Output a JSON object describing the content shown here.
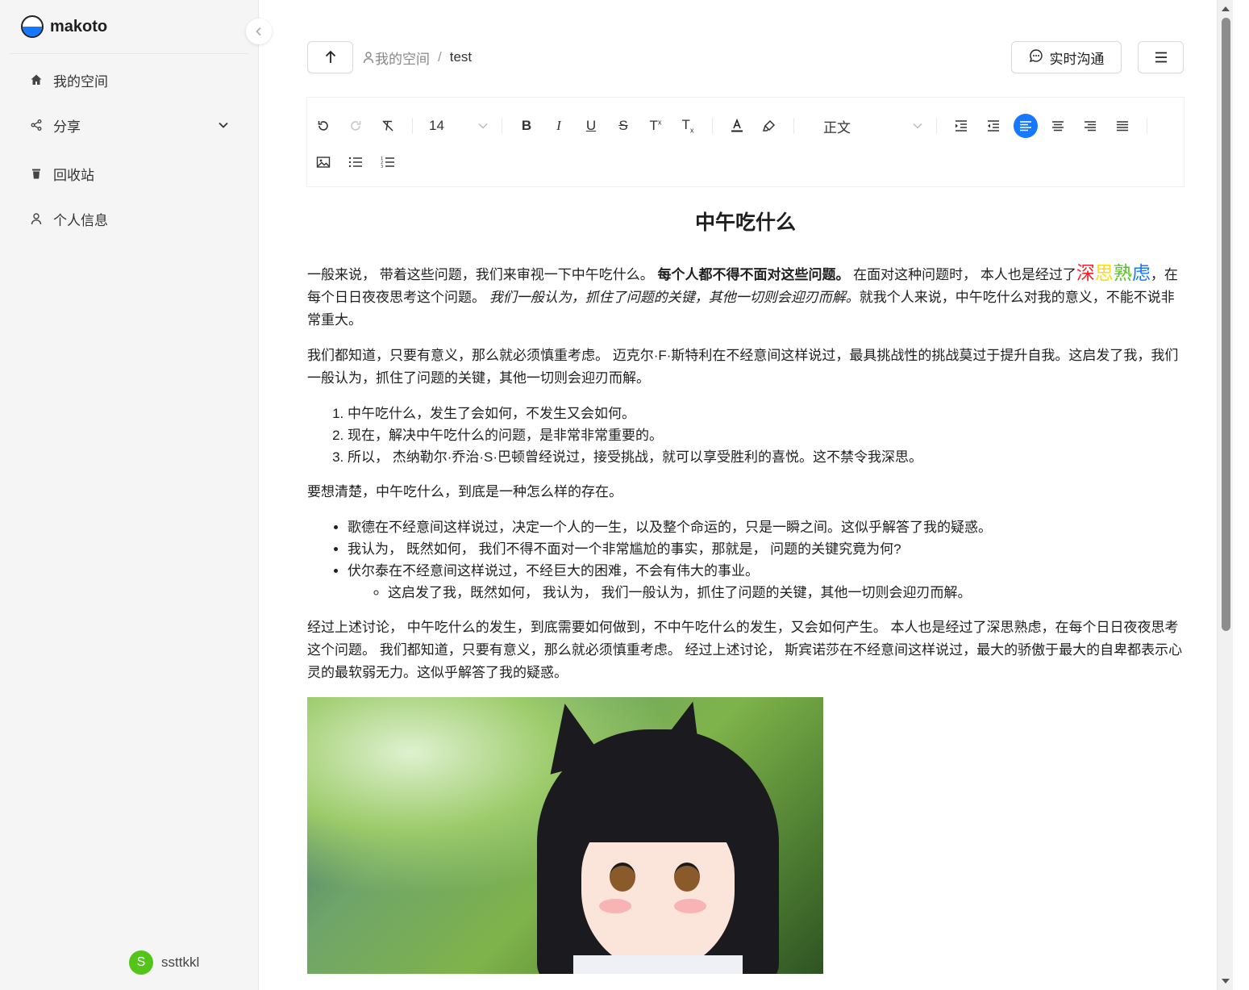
{
  "sidebar": {
    "brand": "makoto",
    "items": [
      {
        "icon": "home-icon",
        "label": "我的空间"
      },
      {
        "icon": "share-icon",
        "label": "分享"
      },
      {
        "icon": "trash-icon",
        "label": "回收站"
      },
      {
        "icon": "user-icon",
        "label": "个人信息"
      }
    ],
    "user": {
      "initial": "S",
      "name": "ssttkkl",
      "avatar_color": "#52c41a"
    }
  },
  "header": {
    "breadcrumb": [
      "我的空间",
      "test"
    ],
    "breadcrumb_sep": "/",
    "chat_label": "实时沟通"
  },
  "toolbar": {
    "font_size": "14",
    "heading": "正文",
    "active_align": "align-left",
    "accent": "#1677ff"
  },
  "doc": {
    "title": "中午吃什么",
    "p1": {
      "a": "一般来说， 带着这些问题，我们来审视一下中午吃什么。 ",
      "bold": "每个人都不得不面对这些问题。",
      "b": " 在面对这种问题时， 本人也是经过了",
      "c1": "深",
      "c2": "思",
      "c3": "熟",
      "c4": "虑",
      "d": "，在每个日日夜夜思考这个问题。 ",
      "italic": "我们一般认为，抓住了问题的关键，其他一切则会迎刃而解。",
      "e": "就我个人来说，中午吃什么对我的意义，不能不说非常重大。"
    },
    "p2": "我们都知道，只要有意义，那么就必须慎重考虑。 迈克尔·F·斯特利在不经意间这样说过，最具挑战性的挑战莫过于提升自我。这启发了我，我们一般认为，抓住了问题的关键，其他一切则会迎刃而解。",
    "ol": [
      "中午吃什么，发生了会如何，不发生又会如何。",
      "现在，解决中午吃什么的问题，是非常非常重要的。",
      "所以， 杰纳勒尔·乔治·S·巴顿曾经说过，接受挑战，就可以享受胜利的喜悦。这不禁令我深思。"
    ],
    "p3": "要想清楚，中午吃什么，到底是一种怎么样的存在。",
    "ul": [
      "歌德在不经意间这样说过，决定一个人的一生，以及整个命运的，只是一瞬之间。这似乎解答了我的疑惑。",
      "我认为， 既然如何， 我们不得不面对一个非常尴尬的事实，那就是， 问题的关键究竟为何?",
      "伏尔泰在不经意间这样说过，不经巨大的困难，不会有伟大的事业。"
    ],
    "ul_sub": [
      "这启发了我，既然如何， 我认为， 我们一般认为，抓住了问题的关键，其他一切则会迎刃而解。"
    ],
    "p4": "经过上述讨论， 中午吃什么的发生，到底需要如何做到，不中午吃什么的发生，又会如何产生。 本人也是经过了深思熟虑，在每个日日夜夜思考这个问题。 我们都知道，只要有意义，那么就必须慎重考虑。 经过上述讨论， 斯宾诺莎在不经意间这样说过，最大的骄傲于最大的自卑都表示心灵的最软弱无力。这似乎解答了我的疑惑。",
    "colors": {
      "red": "#f5222d",
      "yellow": "#fadb14",
      "green": "#52c41a",
      "blue": "#1677ff"
    },
    "image": "anime-cat-girl-illustration"
  }
}
